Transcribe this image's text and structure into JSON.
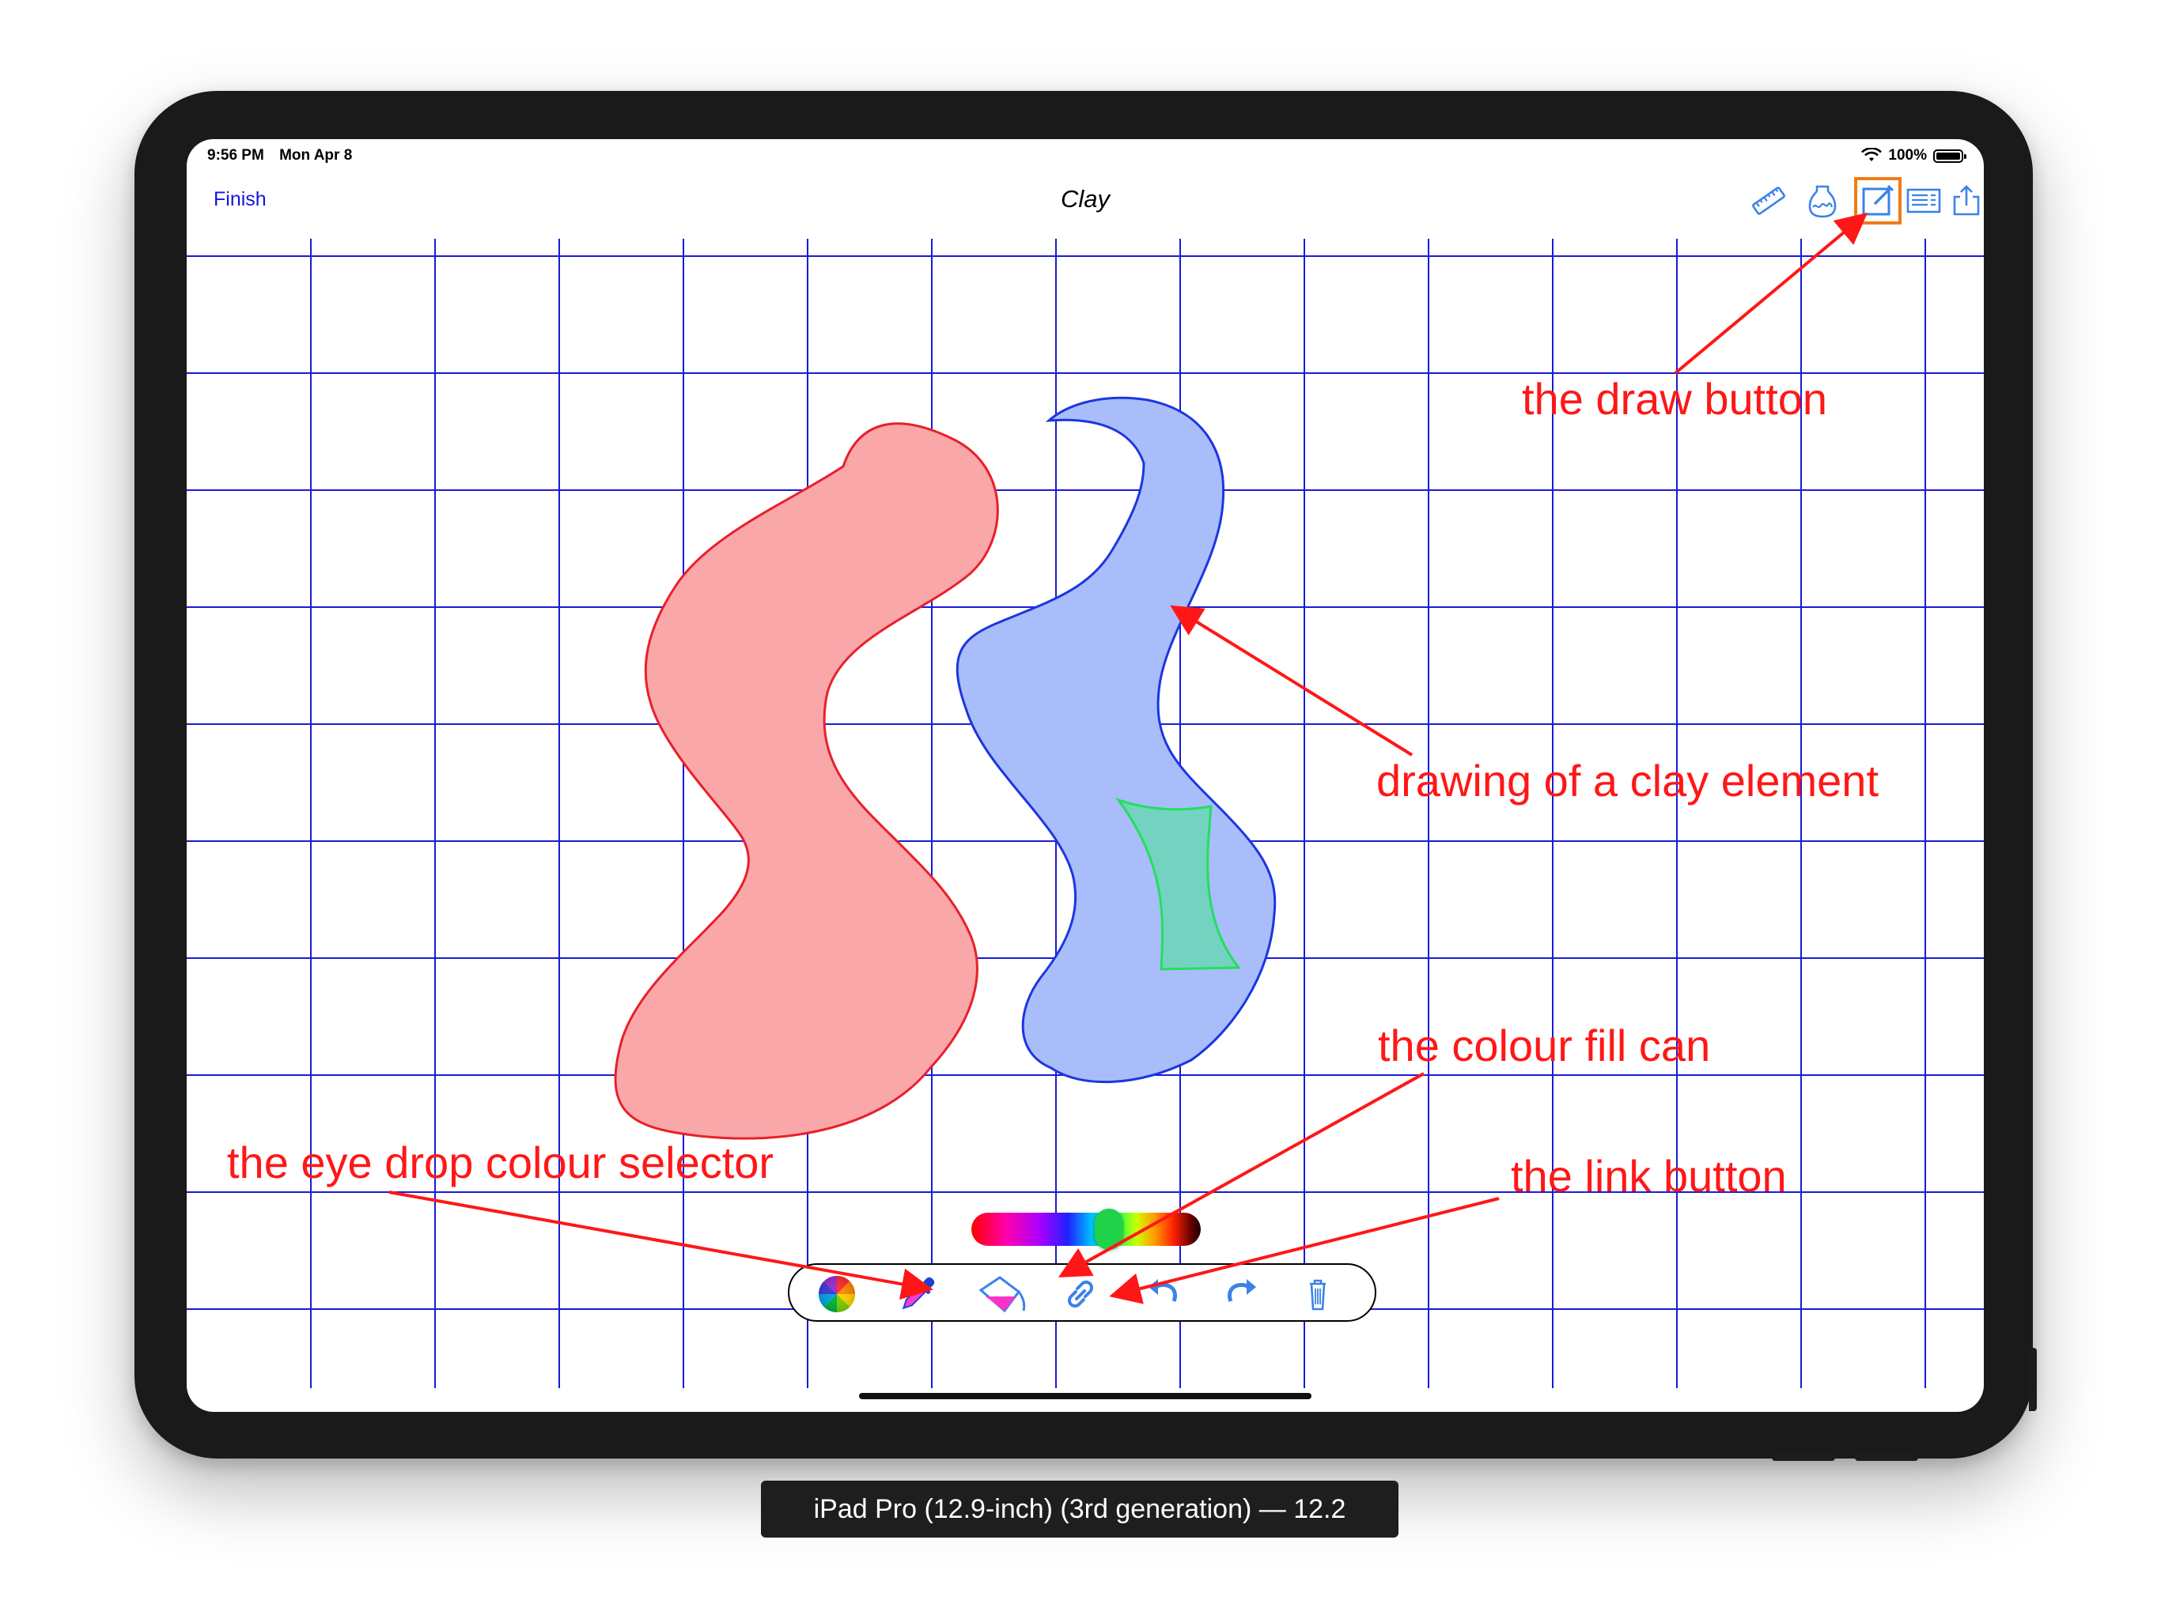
{
  "status_bar": {
    "time": "9:56 PM",
    "date": "Mon Apr 8",
    "battery_percent": "100%",
    "battery_level": 1.0,
    "wifi_icon": "wifi-icon"
  },
  "nav_bar": {
    "finish_label": "Finish",
    "title": "Clay",
    "right_icons": [
      "ruler-icon",
      "vase-icon",
      "draw-icon",
      "list-icon",
      "share-icon"
    ],
    "highlighted_icon": "draw-icon",
    "highlight_color": "#f07c18"
  },
  "canvas": {
    "grid_color": "#1a1ad8",
    "shapes": [
      {
        "name": "red-clay-shape",
        "fill": "#faa7aa",
        "stroke": "#e8202a"
      },
      {
        "name": "blue-clay-shape",
        "fill": "#a9bdfb",
        "stroke": "#1c36e0"
      },
      {
        "name": "green-clay-shape",
        "fill": "#73d3c0",
        "stroke": "#22e05a"
      }
    ]
  },
  "colour_slider": {
    "thumb_color": "#1fd24a"
  },
  "drawing_toolbar": {
    "tools": [
      "colour-wheel-icon",
      "eye-dropper-icon",
      "fill-can-icon",
      "link-icon",
      "undo-icon",
      "redo-icon",
      "trash-icon"
    ]
  },
  "annotations": {
    "color": "#ff1717",
    "draw_button": "the draw button",
    "clay_element": "drawing of a clay element",
    "colour_fill_can": "the colour fill can",
    "eye_drop": "the eye drop colour selector",
    "link_button": "the link button"
  },
  "simulator_label": "iPad Pro (12.9-inch) (3rd generation) — 12.2"
}
